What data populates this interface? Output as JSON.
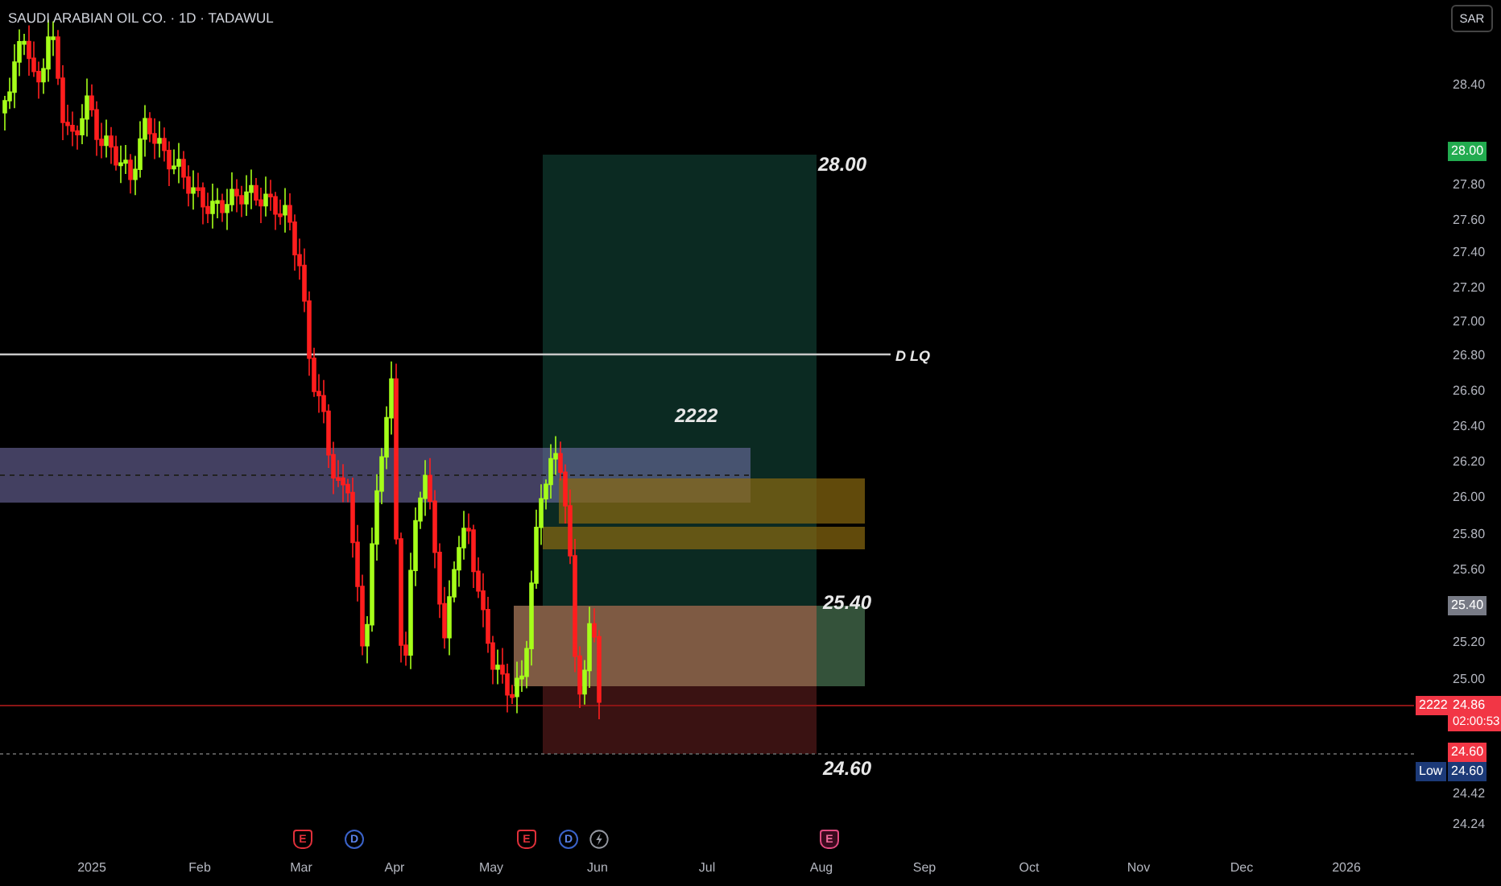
{
  "title": "SAUDI ARABIAN OIL CO. · 1D · TADAWUL",
  "currency": "SAR",
  "chart_labels": {
    "target": "28.00",
    "note": "2222",
    "entry": "25.40",
    "stop": "24.60",
    "line_label": "D LQ"
  },
  "price_ticks": [
    "28.40",
    "27.80",
    "27.60",
    "27.40",
    "27.20",
    "27.00",
    "26.80",
    "26.60",
    "26.40",
    "26.20",
    "26.00",
    "25.80",
    "25.60",
    "25.20",
    "25.00",
    "24.42",
    "24.24"
  ],
  "price_badges": [
    {
      "kind": "target",
      "text": "28.00",
      "color": "#22ab4f"
    },
    {
      "kind": "level",
      "text": "25.40",
      "color": "#787b86"
    },
    {
      "kind": "last",
      "label": "2222",
      "text": "24.86",
      "countdown": "02:00:53",
      "color": "#f23645"
    },
    {
      "kind": "stop",
      "text": "24.60",
      "color": "#f23645"
    },
    {
      "kind": "low",
      "label": "Low",
      "text": "24.60",
      "color": "#1c3a78"
    }
  ],
  "events": [
    {
      "kind": "earnings",
      "label": "E",
      "upcoming": false
    },
    {
      "kind": "dividend",
      "label": "D",
      "upcoming": false
    },
    {
      "kind": "earnings",
      "label": "E",
      "upcoming": false
    },
    {
      "kind": "dividend",
      "label": "D",
      "upcoming": false
    },
    {
      "kind": "flash",
      "upcoming": false
    },
    {
      "kind": "earnings",
      "label": "E",
      "upcoming": true
    }
  ],
  "time_axis": [
    "2025",
    "Feb",
    "Mar",
    "Apr",
    "May",
    "Jun",
    "Jul",
    "Aug",
    "Sep",
    "Oct",
    "Nov",
    "Dec",
    "2026"
  ]
}
